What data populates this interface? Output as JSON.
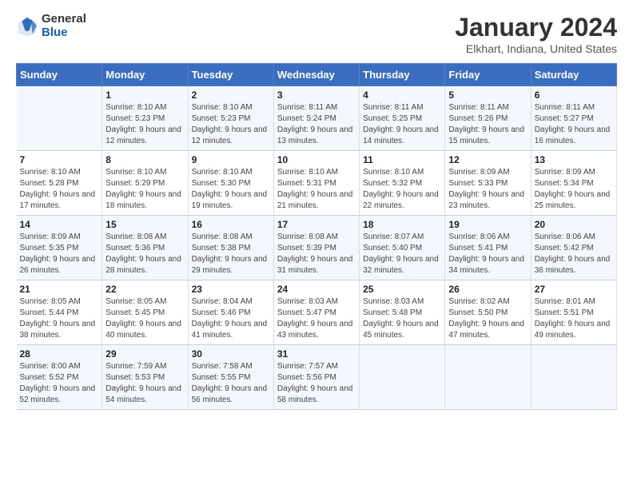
{
  "header": {
    "logo_general": "General",
    "logo_blue": "Blue",
    "month_title": "January 2024",
    "location": "Elkhart, Indiana, United States"
  },
  "days_of_week": [
    "Sunday",
    "Monday",
    "Tuesday",
    "Wednesday",
    "Thursday",
    "Friday",
    "Saturday"
  ],
  "weeks": [
    [
      {
        "day": "",
        "sunrise": "",
        "sunset": "",
        "daylight": ""
      },
      {
        "day": "1",
        "sunrise": "Sunrise: 8:10 AM",
        "sunset": "Sunset: 5:23 PM",
        "daylight": "Daylight: 9 hours and 12 minutes."
      },
      {
        "day": "2",
        "sunrise": "Sunrise: 8:10 AM",
        "sunset": "Sunset: 5:23 PM",
        "daylight": "Daylight: 9 hours and 12 minutes."
      },
      {
        "day": "3",
        "sunrise": "Sunrise: 8:11 AM",
        "sunset": "Sunset: 5:24 PM",
        "daylight": "Daylight: 9 hours and 13 minutes."
      },
      {
        "day": "4",
        "sunrise": "Sunrise: 8:11 AM",
        "sunset": "Sunset: 5:25 PM",
        "daylight": "Daylight: 9 hours and 14 minutes."
      },
      {
        "day": "5",
        "sunrise": "Sunrise: 8:11 AM",
        "sunset": "Sunset: 5:26 PM",
        "daylight": "Daylight: 9 hours and 15 minutes."
      },
      {
        "day": "6",
        "sunrise": "Sunrise: 8:11 AM",
        "sunset": "Sunset: 5:27 PM",
        "daylight": "Daylight: 9 hours and 16 minutes."
      }
    ],
    [
      {
        "day": "7",
        "sunrise": "Sunrise: 8:10 AM",
        "sunset": "Sunset: 5:28 PM",
        "daylight": "Daylight: 9 hours and 17 minutes."
      },
      {
        "day": "8",
        "sunrise": "Sunrise: 8:10 AM",
        "sunset": "Sunset: 5:29 PM",
        "daylight": "Daylight: 9 hours and 18 minutes."
      },
      {
        "day": "9",
        "sunrise": "Sunrise: 8:10 AM",
        "sunset": "Sunset: 5:30 PM",
        "daylight": "Daylight: 9 hours and 19 minutes."
      },
      {
        "day": "10",
        "sunrise": "Sunrise: 8:10 AM",
        "sunset": "Sunset: 5:31 PM",
        "daylight": "Daylight: 9 hours and 21 minutes."
      },
      {
        "day": "11",
        "sunrise": "Sunrise: 8:10 AM",
        "sunset": "Sunset: 5:32 PM",
        "daylight": "Daylight: 9 hours and 22 minutes."
      },
      {
        "day": "12",
        "sunrise": "Sunrise: 8:09 AM",
        "sunset": "Sunset: 5:33 PM",
        "daylight": "Daylight: 9 hours and 23 minutes."
      },
      {
        "day": "13",
        "sunrise": "Sunrise: 8:09 AM",
        "sunset": "Sunset: 5:34 PM",
        "daylight": "Daylight: 9 hours and 25 minutes."
      }
    ],
    [
      {
        "day": "14",
        "sunrise": "Sunrise: 8:09 AM",
        "sunset": "Sunset: 5:35 PM",
        "daylight": "Daylight: 9 hours and 26 minutes."
      },
      {
        "day": "15",
        "sunrise": "Sunrise: 8:08 AM",
        "sunset": "Sunset: 5:36 PM",
        "daylight": "Daylight: 9 hours and 28 minutes."
      },
      {
        "day": "16",
        "sunrise": "Sunrise: 8:08 AM",
        "sunset": "Sunset: 5:38 PM",
        "daylight": "Daylight: 9 hours and 29 minutes."
      },
      {
        "day": "17",
        "sunrise": "Sunrise: 8:08 AM",
        "sunset": "Sunset: 5:39 PM",
        "daylight": "Daylight: 9 hours and 31 minutes."
      },
      {
        "day": "18",
        "sunrise": "Sunrise: 8:07 AM",
        "sunset": "Sunset: 5:40 PM",
        "daylight": "Daylight: 9 hours and 32 minutes."
      },
      {
        "day": "19",
        "sunrise": "Sunrise: 8:06 AM",
        "sunset": "Sunset: 5:41 PM",
        "daylight": "Daylight: 9 hours and 34 minutes."
      },
      {
        "day": "20",
        "sunrise": "Sunrise: 8:06 AM",
        "sunset": "Sunset: 5:42 PM",
        "daylight": "Daylight: 9 hours and 36 minutes."
      }
    ],
    [
      {
        "day": "21",
        "sunrise": "Sunrise: 8:05 AM",
        "sunset": "Sunset: 5:44 PM",
        "daylight": "Daylight: 9 hours and 38 minutes."
      },
      {
        "day": "22",
        "sunrise": "Sunrise: 8:05 AM",
        "sunset": "Sunset: 5:45 PM",
        "daylight": "Daylight: 9 hours and 40 minutes."
      },
      {
        "day": "23",
        "sunrise": "Sunrise: 8:04 AM",
        "sunset": "Sunset: 5:46 PM",
        "daylight": "Daylight: 9 hours and 41 minutes."
      },
      {
        "day": "24",
        "sunrise": "Sunrise: 8:03 AM",
        "sunset": "Sunset: 5:47 PM",
        "daylight": "Daylight: 9 hours and 43 minutes."
      },
      {
        "day": "25",
        "sunrise": "Sunrise: 8:03 AM",
        "sunset": "Sunset: 5:48 PM",
        "daylight": "Daylight: 9 hours and 45 minutes."
      },
      {
        "day": "26",
        "sunrise": "Sunrise: 8:02 AM",
        "sunset": "Sunset: 5:50 PM",
        "daylight": "Daylight: 9 hours and 47 minutes."
      },
      {
        "day": "27",
        "sunrise": "Sunrise: 8:01 AM",
        "sunset": "Sunset: 5:51 PM",
        "daylight": "Daylight: 9 hours and 49 minutes."
      }
    ],
    [
      {
        "day": "28",
        "sunrise": "Sunrise: 8:00 AM",
        "sunset": "Sunset: 5:52 PM",
        "daylight": "Daylight: 9 hours and 52 minutes."
      },
      {
        "day": "29",
        "sunrise": "Sunrise: 7:59 AM",
        "sunset": "Sunset: 5:53 PM",
        "daylight": "Daylight: 9 hours and 54 minutes."
      },
      {
        "day": "30",
        "sunrise": "Sunrise: 7:58 AM",
        "sunset": "Sunset: 5:55 PM",
        "daylight": "Daylight: 9 hours and 56 minutes."
      },
      {
        "day": "31",
        "sunrise": "Sunrise: 7:57 AM",
        "sunset": "Sunset: 5:56 PM",
        "daylight": "Daylight: 9 hours and 58 minutes."
      },
      {
        "day": "",
        "sunrise": "",
        "sunset": "",
        "daylight": ""
      },
      {
        "day": "",
        "sunrise": "",
        "sunset": "",
        "daylight": ""
      },
      {
        "day": "",
        "sunrise": "",
        "sunset": "",
        "daylight": ""
      }
    ]
  ]
}
